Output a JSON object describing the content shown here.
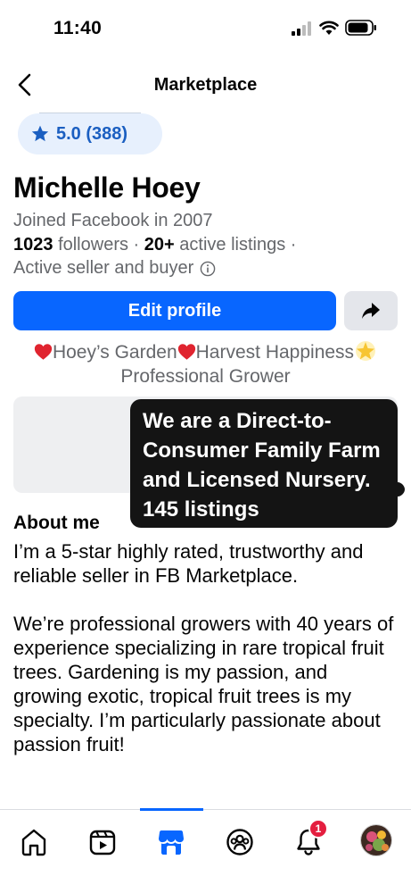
{
  "status_bar": {
    "time": "11:40"
  },
  "header": {
    "title": "Marketplace"
  },
  "profile": {
    "rating": "5.0 (388)",
    "name": "Michelle Hoey",
    "joined": "Joined Facebook in 2007",
    "followers_count": "1023",
    "followers_label": "followers",
    "listings_count": "20+",
    "listings_label": "active listings",
    "seller_status": "Active seller and buyer"
  },
  "actions": {
    "edit_label": "Edit profile"
  },
  "bio": {
    "part1": "Hoey’s Garden",
    "part2": "Harvest Happiness",
    "part3": "Professional Grower"
  },
  "tooltip": {
    "text": "We are a Direct-to-Consumer Family Farm and Licensed Nursery.  145 listings"
  },
  "about": {
    "heading": "About me",
    "paragraph1": "I’m a 5-star highly rated, trustworthy and reliable seller in FB Marketplace.",
    "paragraph2": "We’re professional growers with 40 years of experience specializing in rare tropical fruit trees. Gardening is my passion, and growing exotic, tropical fruit trees is my specialty. I’m particularly passionate about passion fruit!"
  },
  "bottom_nav": {
    "items": [
      "home",
      "video",
      "marketplace",
      "groups",
      "notifications",
      "profile"
    ],
    "active": "marketplace",
    "notification_badge": "1"
  },
  "colors": {
    "accent": "#0866ff",
    "rating_text": "#1b5fc1",
    "badge": "#e41e3f"
  }
}
